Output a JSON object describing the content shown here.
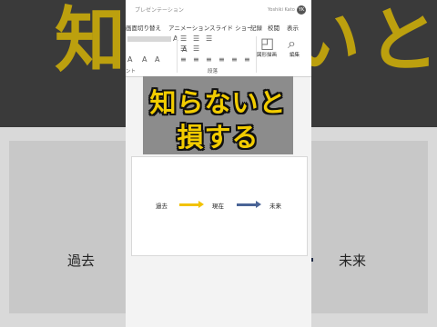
{
  "background": {
    "big_text": "知らないと",
    "left_word": "過去",
    "right_word": "未来"
  },
  "window": {
    "title": "プレゼンテーション",
    "user": "Yoshiki Kato",
    "avatar_initials": "YK"
  },
  "tabs": [
    "画面切り替え",
    "アニメーション",
    "スライド ショー",
    "記録",
    "校閲",
    "表示"
  ],
  "ribbon": {
    "font_group_label": "ント",
    "paragraph_group_label": "段落",
    "drawing_label": "図形描画",
    "editing_label": "編集"
  },
  "banner": {
    "line1": "知らないと",
    "line2": "損する",
    "text_color": "#f2cc00"
  },
  "slide": {
    "past": "過去",
    "present": "現在",
    "future": "未来",
    "arrow1_color": "#f2c200",
    "arrow2_color": "#4a6496"
  }
}
